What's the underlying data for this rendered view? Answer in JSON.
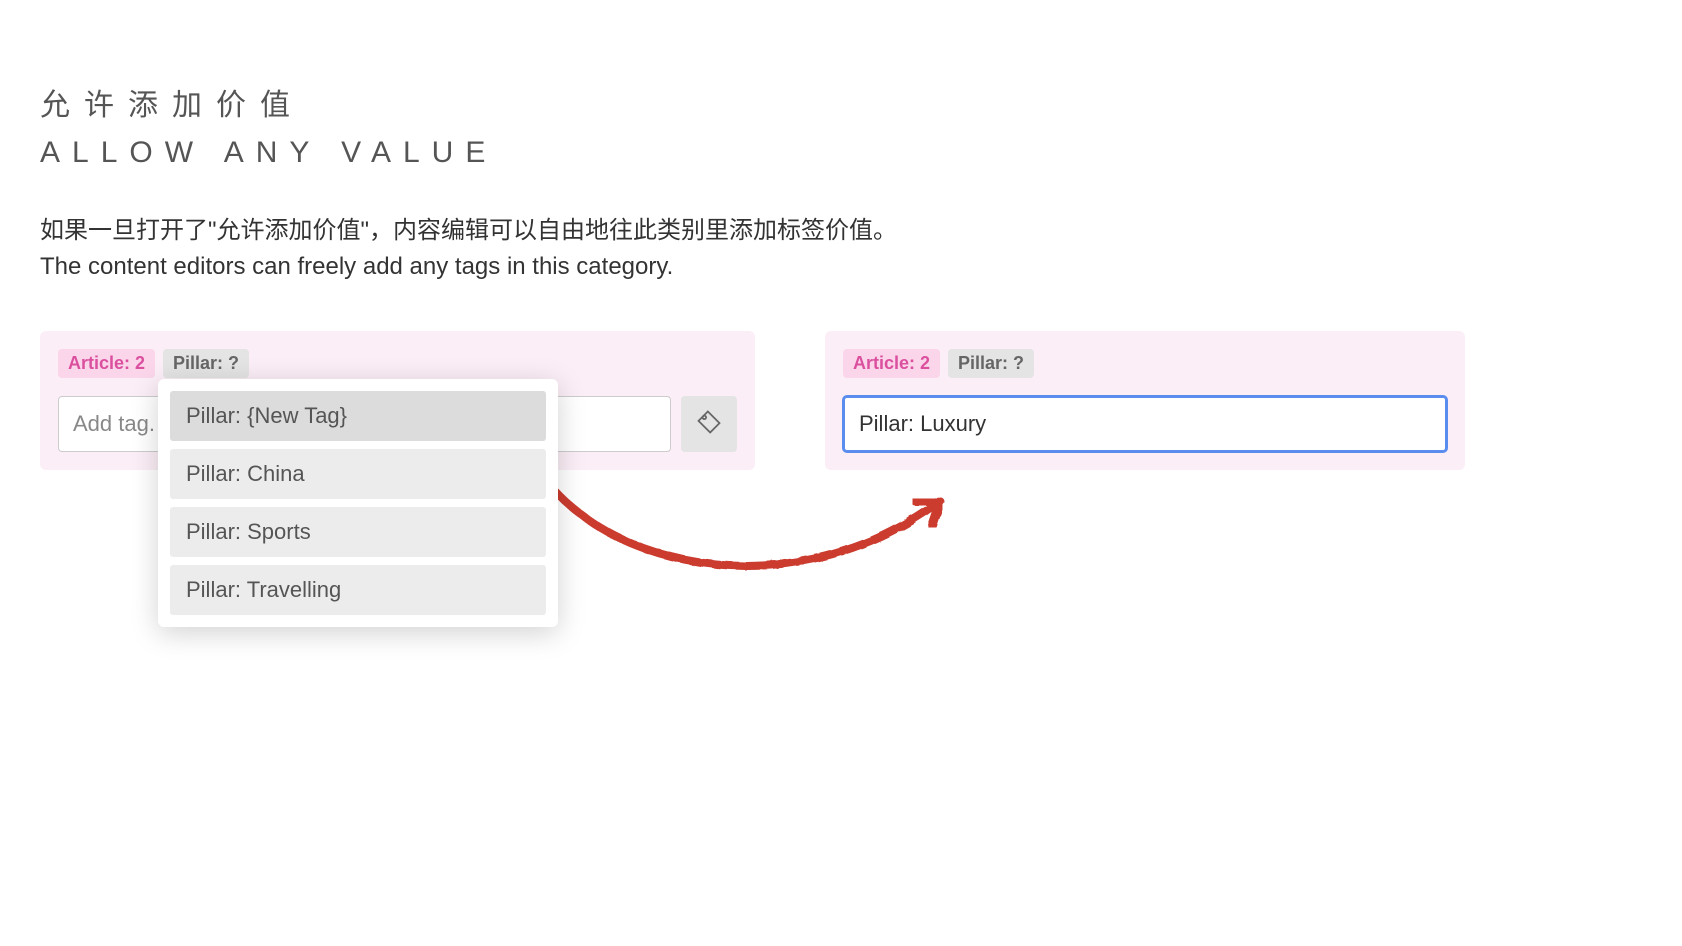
{
  "heading_cn": "允许添加价值",
  "heading_en": "ALLOW ANY VALUE",
  "description_cn": "如果一旦打开了\"允许添加价值\"，内容编辑可以自由地往此类别里添加标签价值。",
  "description_en": "The content editors can freely add any tags in this category.",
  "left_panel": {
    "badges": {
      "article": "Article: 2",
      "pillar": "Pillar: ?"
    },
    "input_placeholder": "Add tag.",
    "dropdown": [
      {
        "label": "Pillar: {New Tag}",
        "hover": true
      },
      {
        "label": "Pillar: China",
        "hover": false
      },
      {
        "label": "Pillar: Sports",
        "hover": false
      },
      {
        "label": "Pillar: Travelling",
        "hover": false
      }
    ]
  },
  "right_panel": {
    "badges": {
      "article": "Article: 2",
      "pillar": "Pillar: ?"
    },
    "input_value": "Pillar: Luxury"
  },
  "colors": {
    "panel_bg": "#fbeef6",
    "article_badge_bg": "#fbd6ea",
    "article_badge_fg": "#db4f9f",
    "focus_border": "#5b8def",
    "annotation": "#cb3a2e"
  }
}
